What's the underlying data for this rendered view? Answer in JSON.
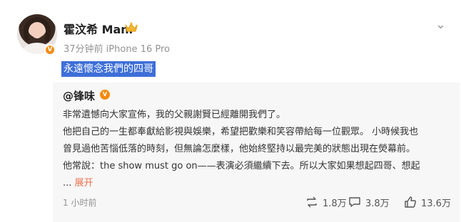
{
  "author": {
    "name": "霍汶希 Mani",
    "verified_badge": "V",
    "meta": "37分钟前 iPhone 16 Pro"
  },
  "post": {
    "text": "永遠懷念我們的四哥"
  },
  "repost": {
    "original_author": "@锋味",
    "verified_badge": "V",
    "lines": [
      "非常遺憾向大家宣佈，我的父親謝賢已經離開我們了。",
      "他把自己的一生都奉獻給影視與娛樂，希望把歡樂和笑容帶給每一位觀眾。 小時候我也",
      "曾見過他苦惱低落的時刻，但無論怎麼樣，他始終堅持以最完美的狀態出現在熒幕前。",
      "他常說：the show must go on——表演必須繼續下去。所以大家如果想起四哥、想起"
    ],
    "ellipsis": "...",
    "expand_label": "展开",
    "time": "1 小时前",
    "stats": {
      "reposts": "1.8万",
      "comments": "3.8万",
      "likes": "13.6万"
    }
  },
  "colors": {
    "accent_orange": "#eb7350",
    "badge_orange": "#f58b0f",
    "highlight_blue": "#3e6fd8"
  },
  "icons": [
    "crown-icon",
    "more-icon",
    "repost-icon",
    "comment-icon",
    "like-icon",
    "verified-badge-icon"
  ]
}
